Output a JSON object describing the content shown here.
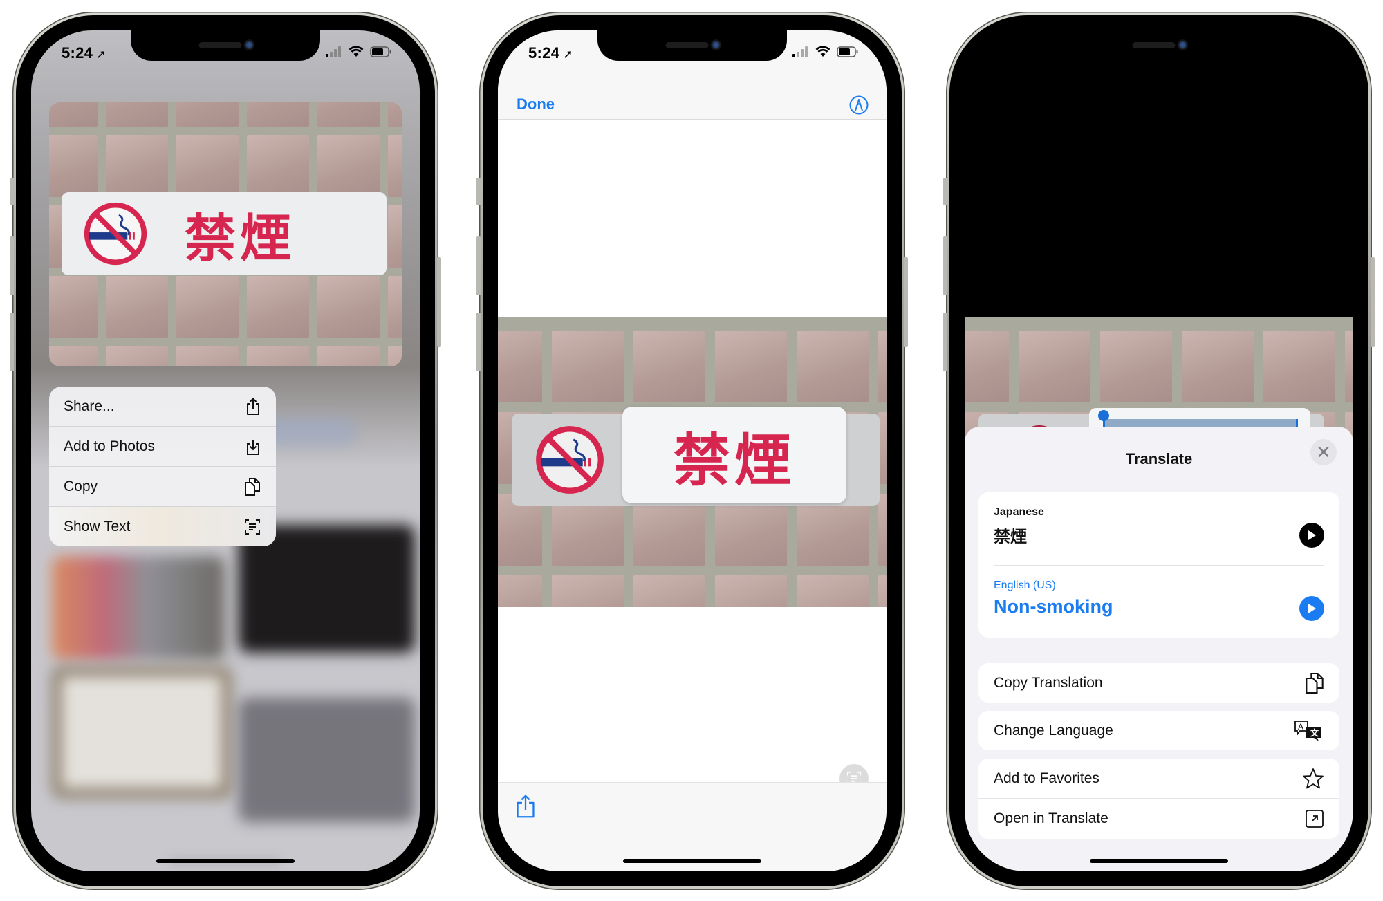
{
  "status_bar": {
    "time": "5:24",
    "location_icon": "location-arrow-icon"
  },
  "phone1": {
    "context_menu": [
      {
        "label": "Share...",
        "icon": "share-icon"
      },
      {
        "label": "Add to Photos",
        "icon": "add-to-photos-icon"
      },
      {
        "label": "Copy",
        "icon": "copy-icon"
      },
      {
        "label": "Show Text",
        "icon": "live-text-icon"
      }
    ]
  },
  "photo": {
    "sign_text": "禁煙"
  },
  "phone2": {
    "done_label": "Done",
    "markup_icon": "markup-icon",
    "live_text_icon": "live-text-icon",
    "share_icon": "share-icon"
  },
  "phone3": {
    "sheet_title": "Translate",
    "close_icon": "close-icon",
    "source": {
      "language": "Japanese",
      "text": "禁煙"
    },
    "target": {
      "language": "English (US)",
      "text": "Non-smoking"
    },
    "actions": [
      {
        "label": "Copy Translation",
        "icon": "copy-icon"
      },
      {
        "label": "Change Language",
        "icon": "translate-icon"
      },
      {
        "label": "Add to Favorites",
        "icon": "star-icon"
      },
      {
        "label": "Open in Translate",
        "icon": "open-external-icon"
      }
    ]
  },
  "colors": {
    "accent_blue": "#1a7cf0",
    "sign_red": "#d6264f",
    "sheet_bg": "#f2f2f7"
  }
}
